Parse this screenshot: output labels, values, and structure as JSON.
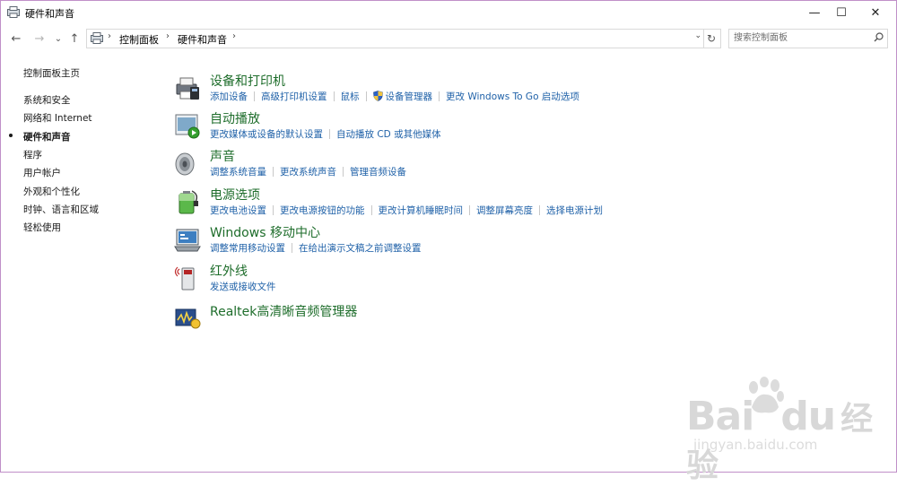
{
  "window": {
    "title": "硬件和声音",
    "min_label": "—",
    "max_label": "☐",
    "close_label": "✕"
  },
  "nav": {
    "back_glyph": "←",
    "forward_glyph": "→",
    "recent_glyph": "⌄",
    "up_glyph": "↑",
    "breadcrumb": [
      "控制面板",
      "硬件和声音"
    ],
    "separator": "›",
    "dropdown_glyph": "⌄",
    "refresh_glyph": "↻",
    "search_placeholder": "搜索控制面板",
    "search_icon": "search-icon"
  },
  "sidebar": {
    "items": [
      {
        "label": "控制面板主页",
        "current": false
      },
      {
        "label": "系统和安全",
        "current": false
      },
      {
        "label": "网络和 Internet",
        "current": false
      },
      {
        "label": "硬件和声音",
        "current": true
      },
      {
        "label": "程序",
        "current": false
      },
      {
        "label": "用户帐户",
        "current": false
      },
      {
        "label": "外观和个性化",
        "current": false
      },
      {
        "label": "时钟、语言和区域",
        "current": false
      },
      {
        "label": "轻松使用",
        "current": false
      }
    ]
  },
  "categories": [
    {
      "title": "设备和打印机",
      "icon": "printer-icon",
      "links": [
        "添加设备",
        "高级打印机设置",
        "鼠标",
        "设备管理器",
        "更改 Windows To Go 启动选项"
      ]
    },
    {
      "title": "自动播放",
      "icon": "autoplay-icon",
      "links": [
        "更改媒体或设备的默认设置",
        "自动播放 CD 或其他媒体"
      ]
    },
    {
      "title": "声音",
      "icon": "speaker-icon",
      "links": [
        "调整系统音量",
        "更改系统声音",
        "管理音频设备"
      ]
    },
    {
      "title": "电源选项",
      "icon": "battery-icon",
      "links": [
        "更改电池设置",
        "更改电源按钮的功能",
        "更改计算机睡眠时间",
        "调整屏幕亮度",
        "选择电源计划"
      ]
    },
    {
      "title": "Windows 移动中心",
      "icon": "mobility-center-icon",
      "links": [
        "调整常用移动设置",
        "在给出演示文稿之前调整设置"
      ]
    },
    {
      "title": "红外线",
      "icon": "infrared-icon",
      "links": [
        "发送或接收文件"
      ]
    },
    {
      "title": "Realtek高清晰音频管理器",
      "icon": "realtek-audio-icon",
      "links": []
    }
  ],
  "colors": {
    "category_title": "#1e6d2b",
    "link": "#1f61a8",
    "frame_border": "#c08fc8"
  },
  "watermark": {
    "line1_a": "Bai",
    "line1_b": "du",
    "line1_c": "经验",
    "line2": "jingyan.baidu.com"
  }
}
